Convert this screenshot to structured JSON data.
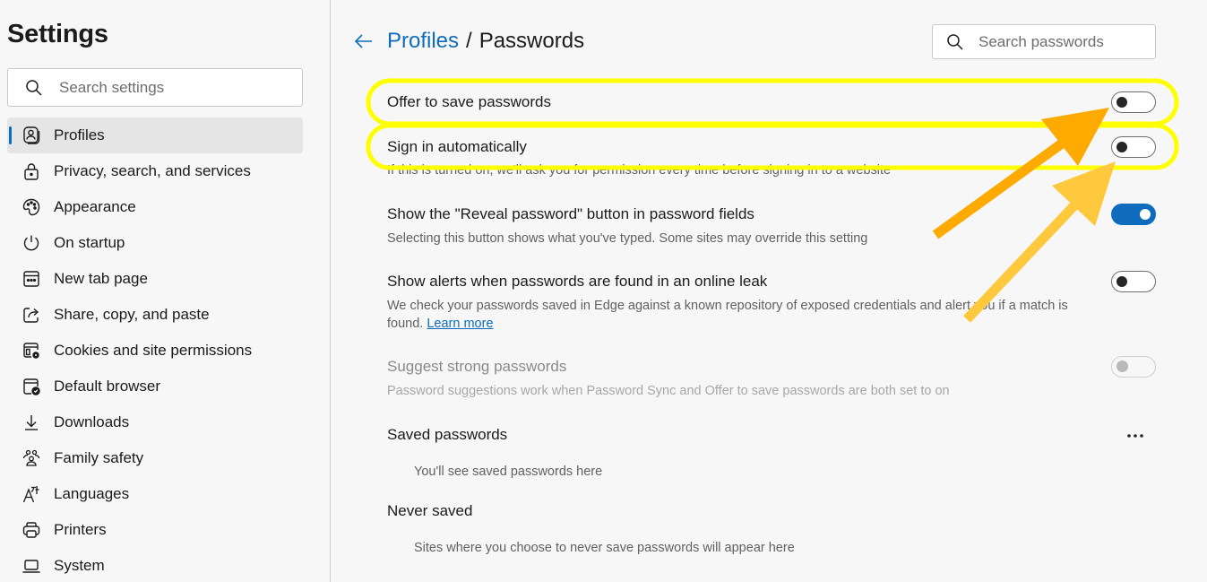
{
  "sidebar": {
    "title": "Settings",
    "search_placeholder": "Search settings",
    "items": [
      {
        "label": "Profiles",
        "icon": "profile-icon",
        "active": true
      },
      {
        "label": "Privacy, search, and services",
        "icon": "lock-icon"
      },
      {
        "label": "Appearance",
        "icon": "palette-icon"
      },
      {
        "label": "On startup",
        "icon": "power-icon"
      },
      {
        "label": "New tab page",
        "icon": "new-tab-icon"
      },
      {
        "label": "Share, copy, and paste",
        "icon": "share-icon"
      },
      {
        "label": "Cookies and site permissions",
        "icon": "cookies-settings-icon"
      },
      {
        "label": "Default browser",
        "icon": "default-browser-icon"
      },
      {
        "label": "Downloads",
        "icon": "download-icon"
      },
      {
        "label": "Family safety",
        "icon": "family-icon"
      },
      {
        "label": "Languages",
        "icon": "languages-icon"
      },
      {
        "label": "Printers",
        "icon": "printer-icon"
      },
      {
        "label": "System",
        "icon": "laptop-icon"
      }
    ]
  },
  "header": {
    "back_icon": "arrow-left-icon",
    "breadcrumb_parent": "Profiles",
    "breadcrumb_separator": "/",
    "breadcrumb_current": "Passwords",
    "search_placeholder": "Search passwords"
  },
  "settings": [
    {
      "title": "Offer to save passwords",
      "description": "",
      "enabled": false,
      "disabled": false,
      "highlighted": true
    },
    {
      "title": "Sign in automatically",
      "description": "If this is turned on, we'll ask you for permission every time before signing in to a website",
      "enabled": false,
      "disabled": false,
      "highlighted": true
    },
    {
      "title": "Show the \"Reveal password\" button in password fields",
      "description": "Selecting this button shows what you've typed. Some sites may override this setting",
      "enabled": true,
      "disabled": false
    },
    {
      "title": "Show alerts when passwords are found in an online leak",
      "description": "We check your passwords saved in Edge against a known repository of exposed credentials and alert you if a match is found.",
      "link": "Learn more",
      "enabled": false,
      "disabled": false
    },
    {
      "title": "Suggest strong passwords",
      "description": "Password suggestions work when Password Sync and Offer to save passwords are both set to on",
      "enabled": false,
      "disabled": true
    }
  ],
  "saved_passwords": {
    "title": "Saved passwords",
    "empty_message": "You'll see saved passwords here",
    "more_icon": "more-horizontal-icon"
  },
  "never_saved": {
    "title": "Never saved",
    "empty_message": "Sites where you choose to never save passwords will appear here"
  },
  "annotations": {
    "highlight_color": "#ffff00",
    "arrow_colors": [
      "#ffaa00",
      "#ffc83d"
    ]
  },
  "colors": {
    "accent": "#0f6cbd",
    "background": "#f7f7f7"
  }
}
